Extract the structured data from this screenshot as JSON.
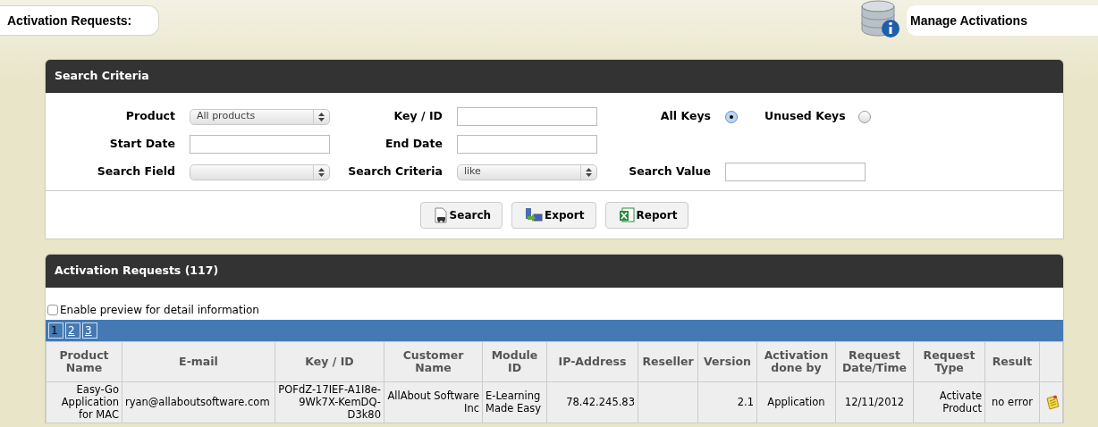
{
  "header": {
    "page_tab": "Activation Requests:",
    "manage_tab": "Manage Activations"
  },
  "search_panel": {
    "title": "Search Criteria",
    "rows": [
      [
        {
          "label": "Product",
          "kind": "select",
          "value": "All products"
        },
        {
          "label": "Key / ID",
          "kind": "input"
        },
        {
          "kind": "radios",
          "options": [
            {
              "label": "All Keys",
              "selected": true
            },
            {
              "label": "Unused Keys",
              "selected": false
            }
          ]
        }
      ],
      [
        {
          "label": "Start Date",
          "kind": "input"
        },
        {
          "label": "End Date",
          "kind": "input"
        }
      ],
      [
        {
          "label": "Search Field",
          "kind": "select"
        },
        {
          "label": "Search Criteria",
          "kind": "select",
          "value": "like"
        },
        {
          "label": "Search Value",
          "kind": "input"
        }
      ]
    ],
    "buttons": [
      {
        "label": "Search",
        "kind": "search"
      },
      {
        "label": "Export",
        "kind": "export"
      },
      {
        "label": "Report",
        "kind": "report"
      }
    ]
  },
  "results_panel": {
    "title": "Activation Requests (117)",
    "preview_option": {
      "label": "Enable preview for detail information",
      "checked": false
    },
    "pages": [
      {
        "label": "1",
        "selected": true
      },
      {
        "label": "2",
        "selected": false
      },
      {
        "label": "3",
        "selected": false
      }
    ],
    "table": {
      "columns": [
        "Product Name",
        "E-mail",
        "Key / ID",
        "Customer Name",
        "Module ID",
        "IP-Address",
        "Reseller",
        "Version",
        "Activation done by",
        "Request Date/Time",
        "Request Type",
        "Result"
      ],
      "rows": [
        {
          "cells": [
            "Easy-Go Application for MAC",
            "ryan@allaboutsoftware.com",
            "POFdZ-17IEF-A1I8e-9Wk7X-KemDQ-D3k80",
            "AllAbout Software Inc",
            "E-Learning Made Easy",
            "78.42.245.83",
            "",
            "2.1",
            "Application",
            "12/11/2012",
            "Activate Product",
            "no error"
          ]
        }
      ]
    }
  }
}
